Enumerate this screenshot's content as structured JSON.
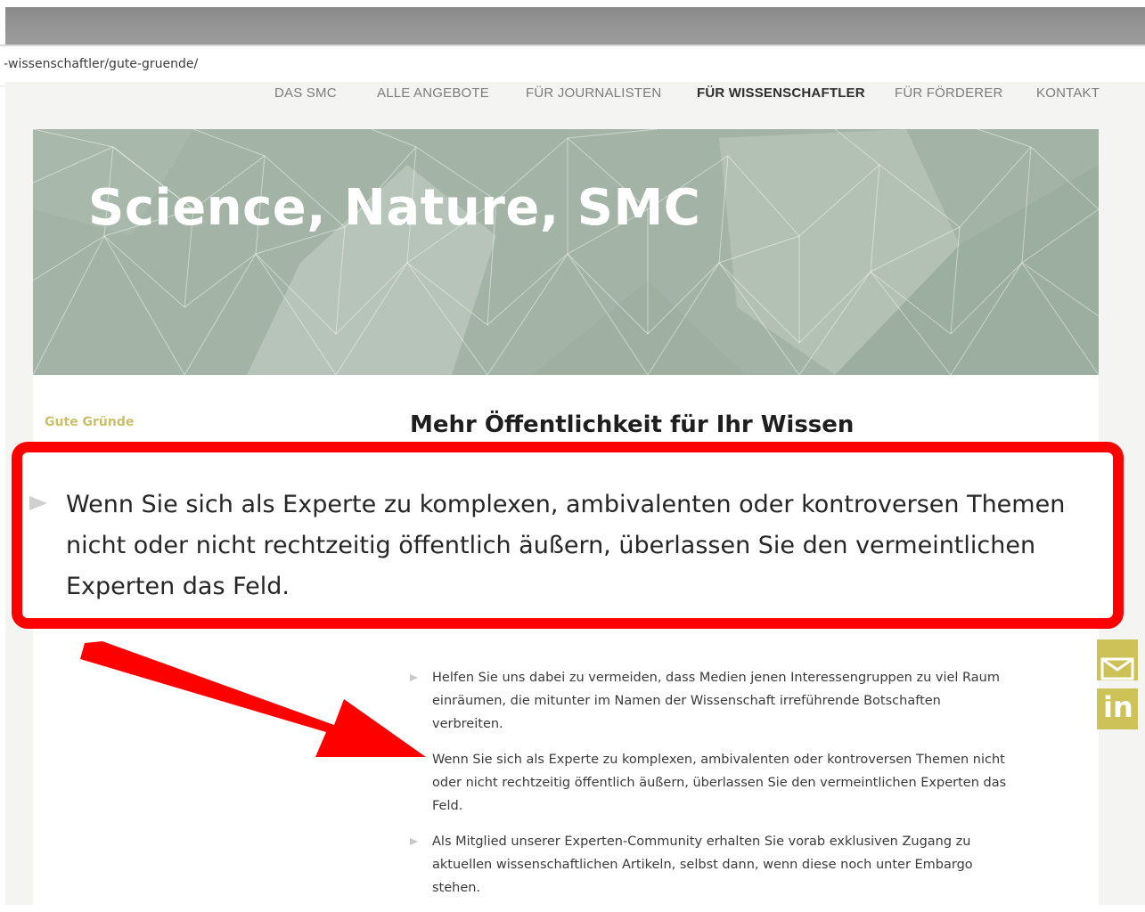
{
  "browser": {
    "url": "-wissenschaftler/gute-gruende/"
  },
  "nav": {
    "items": [
      {
        "label": "DAS SMC",
        "active": false
      },
      {
        "label": "ALLE ANGEBOTE",
        "active": false
      },
      {
        "label": "FÜR JOURNALISTEN",
        "active": false
      },
      {
        "label": "FÜR WISSENSCHAFTLER",
        "active": true
      },
      {
        "label": "FÜR FÖRDERER",
        "active": false
      },
      {
        "label": "KONTAKT",
        "active": false
      }
    ]
  },
  "hero": {
    "title": "Science, Nature, SMC",
    "background_color": "#a3b4a6"
  },
  "page": {
    "breadcrumb": "Gute Gründe",
    "headline": "Mehr Öffentlichkeit für Ihr Wissen"
  },
  "callout": {
    "text": "Wenn Sie sich als Experte zu komplexen, ambivalenten oder kontroversen Themen nicht oder nicht rechtzeitig öffentlich äußern, überlassen Sie den vermeintlichen Experten das Feld.",
    "border_color": "#ff0000"
  },
  "list": {
    "items": [
      "Helfen Sie uns dabei zu vermeiden, dass Medien jenen Interessengruppen zu viel Raum einräumen, die mitunter im Namen der Wissenschaft irreführende Botschaften verbreiten.",
      "Wenn Sie sich als Experte zu komplexen, ambivalenten oder kontroversen Themen nicht oder nicht rechtzeitig öffentlich äußern, überlassen Sie den vermeintlichen Experten das Feld.",
      "Als Mitglied unserer Experten-Community erhalten Sie vorab exklusiven Zugang zu aktuellen wissenschaftlichen Artikeln, selbst dann, wenn diese noch unter Embargo stehen."
    ]
  },
  "social": {
    "icons": [
      "mail-icon",
      "linkedin-icon"
    ],
    "color": "#cdc257",
    "linkedin_label": "in"
  },
  "annotation": {
    "arrow_color": "#ff0000"
  }
}
